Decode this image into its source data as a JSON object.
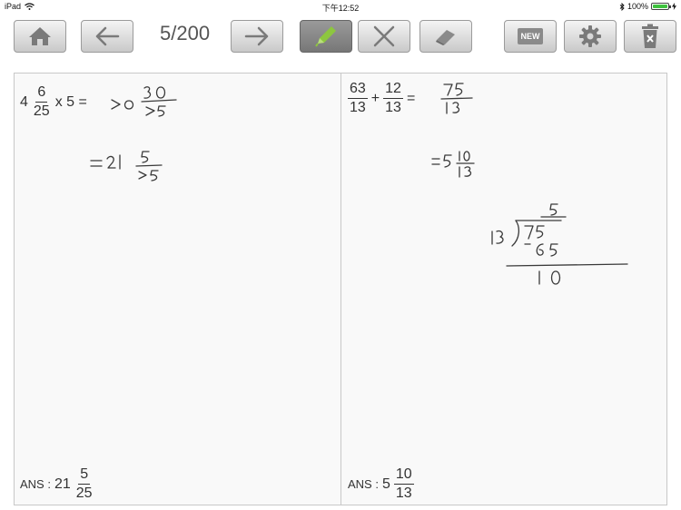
{
  "status_bar": {
    "device": "iPad",
    "time": "下午12:52",
    "battery_text": "100%",
    "battery_level": 1.0
  },
  "toolbar": {
    "counter": "5/200",
    "new_label": "NEW",
    "active_tool": "pencil",
    "accent_color": "#8dc63f"
  },
  "problems": [
    {
      "whole": "4",
      "frac_num": "6",
      "frac_den": "25",
      "rest": "x 5 =",
      "ans_label": "ANS :",
      "ans_whole": "21",
      "ans_num": "5",
      "ans_den": "25"
    },
    {
      "a_num": "63",
      "a_den": "13",
      "op": "+",
      "b_num": "12",
      "b_den": "13",
      "eq": "=",
      "ans_label": "ANS :",
      "ans_whole": "5",
      "ans_num": "10",
      "ans_den": "13"
    }
  ]
}
